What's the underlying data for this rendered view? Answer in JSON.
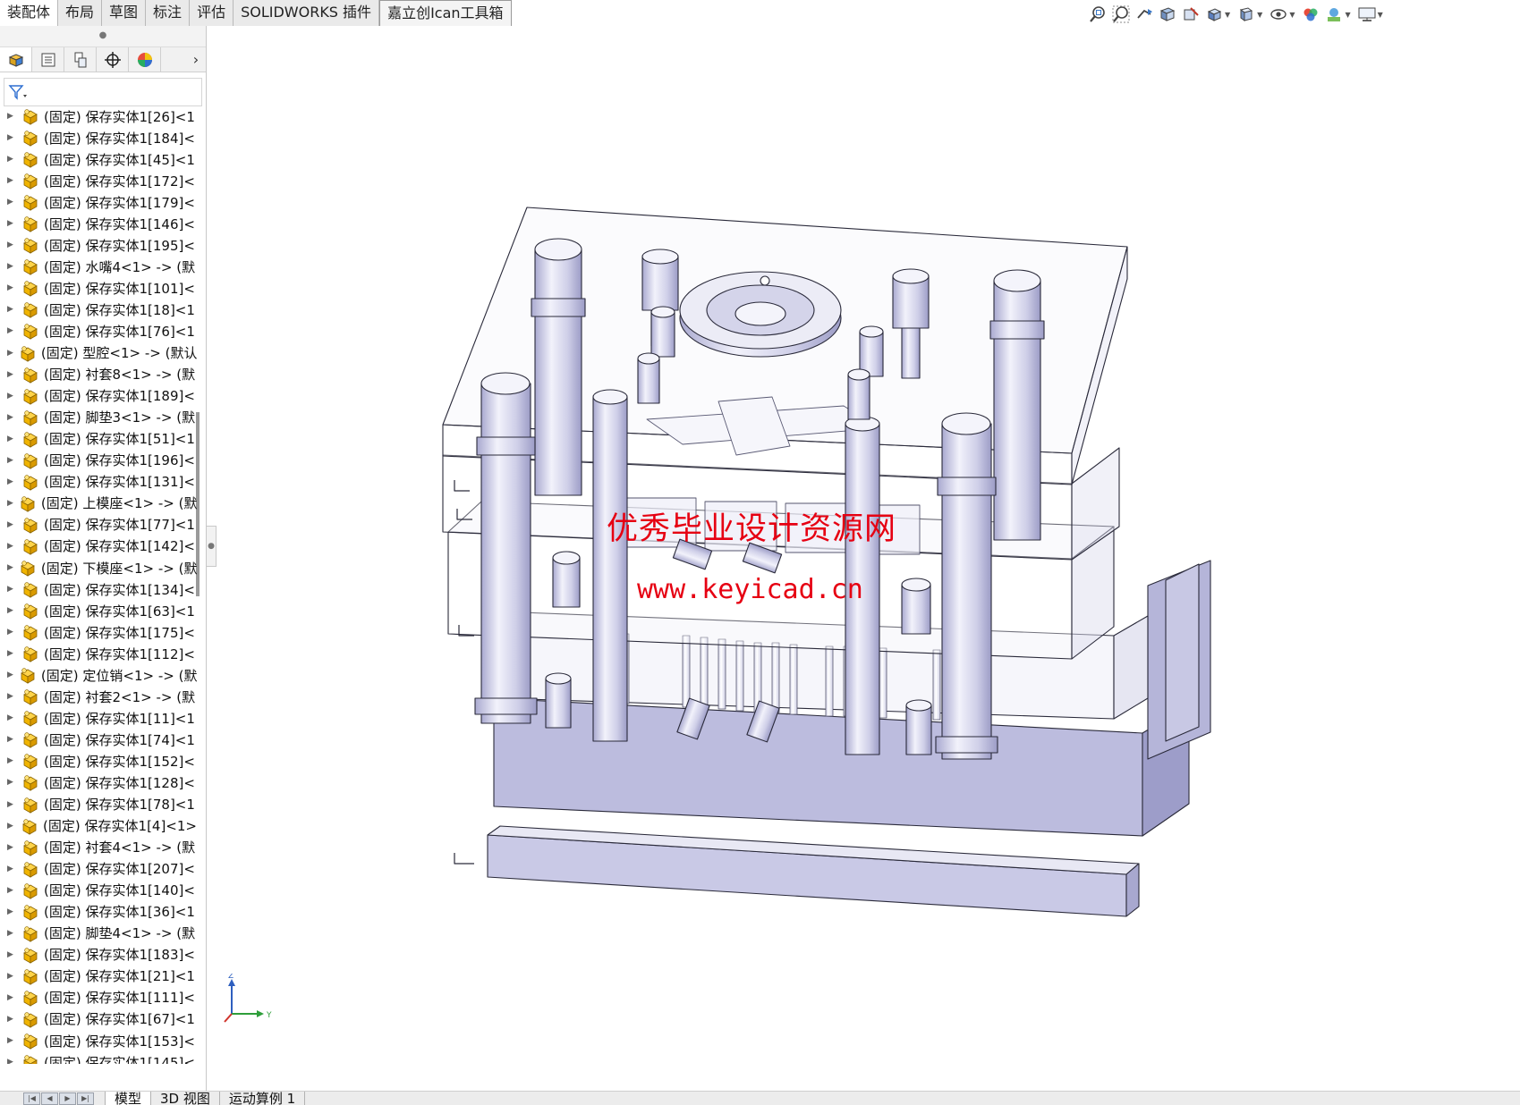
{
  "command_tabs": [
    "装配体",
    "布局",
    "草图",
    "标注",
    "评估",
    "SOLIDWORKS 插件",
    "嘉立创Ican工具箱"
  ],
  "hud_icons": [
    "zoom-to-fit-icon",
    "zoom-area-icon",
    "previous-view-icon",
    "section-view-icon",
    "dynamic-annotation-icon",
    "view-orientation-icon",
    "display-style-icon",
    "hide-show-items-icon",
    "edit-appearance-icon",
    "apply-scene-icon",
    "view-settings-icon"
  ],
  "panel_tabs": [
    "feature-manager-tab-icon",
    "property-manager-tab-icon",
    "configuration-manager-tab-icon",
    "dimxpert-manager-tab-icon",
    "display-manager-tab-icon"
  ],
  "tree_items": [
    "(固定) 保存实体1[26]<1",
    "(固定) 保存实体1[184]<",
    "(固定) 保存实体1[45]<1",
    "(固定) 保存实体1[172]<",
    "(固定) 保存实体1[179]<",
    "(固定) 保存实体1[146]<",
    "(固定) 保存实体1[195]<",
    "(固定) 水嘴4<1> -> (默",
    "(固定) 保存实体1[101]<",
    "(固定) 保存实体1[18]<1",
    "(固定) 保存实体1[76]<1",
    "(固定) 型腔<1> -> (默认",
    "(固定) 衬套8<1> -> (默",
    "(固定) 保存实体1[189]<",
    "(固定) 脚垫3<1> -> (默",
    "(固定) 保存实体1[51]<1",
    "(固定) 保存实体1[196]<",
    "(固定) 保存实体1[131]<",
    "(固定) 上模座<1> -> (默",
    "(固定) 保存实体1[77]<1",
    "(固定) 保存实体1[142]<",
    "(固定) 下模座<1> -> (默",
    "(固定) 保存实体1[134]<",
    "(固定) 保存实体1[63]<1",
    "(固定) 保存实体1[175]<",
    "(固定) 保存实体1[112]<",
    "(固定) 定位销<1> -> (默",
    "(固定) 衬套2<1> -> (默",
    "(固定) 保存实体1[11]<1",
    "(固定) 保存实体1[74]<1",
    "(固定) 保存实体1[152]<",
    "(固定) 保存实体1[128]<",
    "(固定) 保存实体1[78]<1",
    "(固定) 保存实体1[4]<1>",
    "(固定) 衬套4<1> -> (默",
    "(固定) 保存实体1[207]<",
    "(固定) 保存实体1[140]<",
    "(固定) 保存实体1[36]<1",
    "(固定) 脚垫4<1> -> (默",
    "(固定) 保存实体1[183]<",
    "(固定) 保存实体1[21]<1",
    "(固定) 保存实体1[111]<",
    "(固定) 保存实体1[67]<1",
    "(固定) 保存实体1[153]<",
    "(固定) 保存实体1[145]<"
  ],
  "bottom_tabs": [
    "模型",
    "3D 视图",
    "运动算例 1"
  ],
  "watermark": {
    "line1": "优秀毕业设计资源网",
    "line2": "www.keyicad.cn"
  },
  "triad": {
    "z": "Z",
    "y": "Y"
  },
  "colors": {
    "watermark": "#e60012",
    "part_fill": "#d0d0ea",
    "part_edge": "#2a2a3a",
    "component_icon": "#f0b400"
  }
}
